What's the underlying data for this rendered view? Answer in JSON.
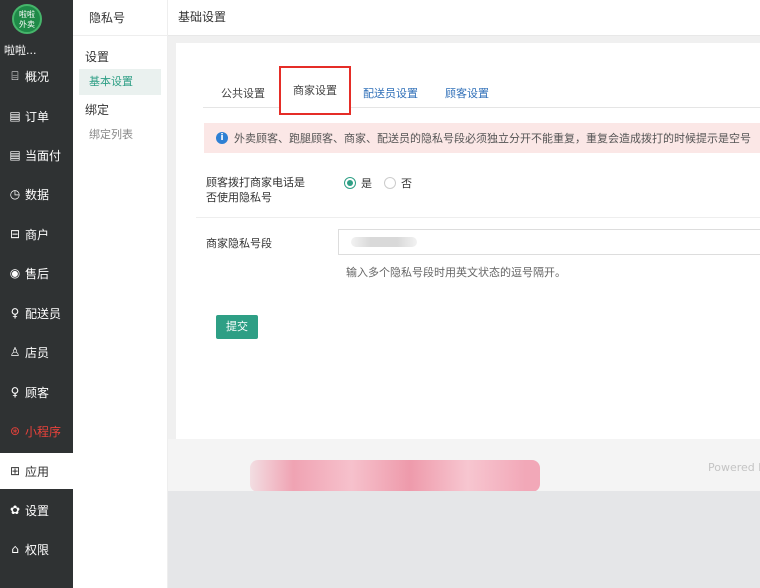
{
  "logo": {
    "line1": "啦啦",
    "line2": "外卖"
  },
  "shop_name": "啦啦...",
  "nav": {
    "items": [
      {
        "icon": "⌸",
        "label": "概况"
      },
      {
        "icon": "▤",
        "label": "订单"
      },
      {
        "icon": "▤",
        "label": "当面付"
      },
      {
        "icon": "◷",
        "label": "数据"
      },
      {
        "icon": "⊟",
        "label": "商户"
      },
      {
        "icon": "◉",
        "label": "售后"
      },
      {
        "icon": "♀",
        "label": "配送员"
      },
      {
        "icon": "♙",
        "label": "店员"
      },
      {
        "icon": "♀",
        "label": "顾客"
      },
      {
        "icon": "⊛",
        "label": "小程序"
      },
      {
        "icon": "⊞",
        "label": "应用"
      },
      {
        "icon": "✿",
        "label": "设置"
      },
      {
        "icon": "⌂",
        "label": "权限"
      }
    ]
  },
  "subnav": {
    "title": "隐私号",
    "group1": "设置",
    "item_basic": "基本设置",
    "group2": "绑定",
    "item_bind_list": "绑定列表"
  },
  "topbar": {
    "title": "基础设置"
  },
  "tabs": [
    "公共设置",
    "商家设置",
    "配送员设置",
    "顾客设置"
  ],
  "alert": {
    "text": "外卖顾客、跑腿顾客、商家、配送员的隐私号段必须独立分开不能重复，重复会造成拨打的时候提示是空号"
  },
  "form": {
    "use_privacy_label_line1": "顾客拨打商家电话是",
    "use_privacy_label_line2": "否使用隐私号",
    "yes": "是",
    "no": "否",
    "segment_label": "商家隐私号段",
    "segment_hint": "输入多个隐私号段时用英文状态的逗号隔开。",
    "submit": "提交"
  },
  "footer": {
    "powered": "Powered b"
  },
  "colors": {
    "primary": "#2e9f85",
    "nav_bg": "#2f3233",
    "alert_bg": "#fbe7e6",
    "highlight": "#e52d27"
  }
}
